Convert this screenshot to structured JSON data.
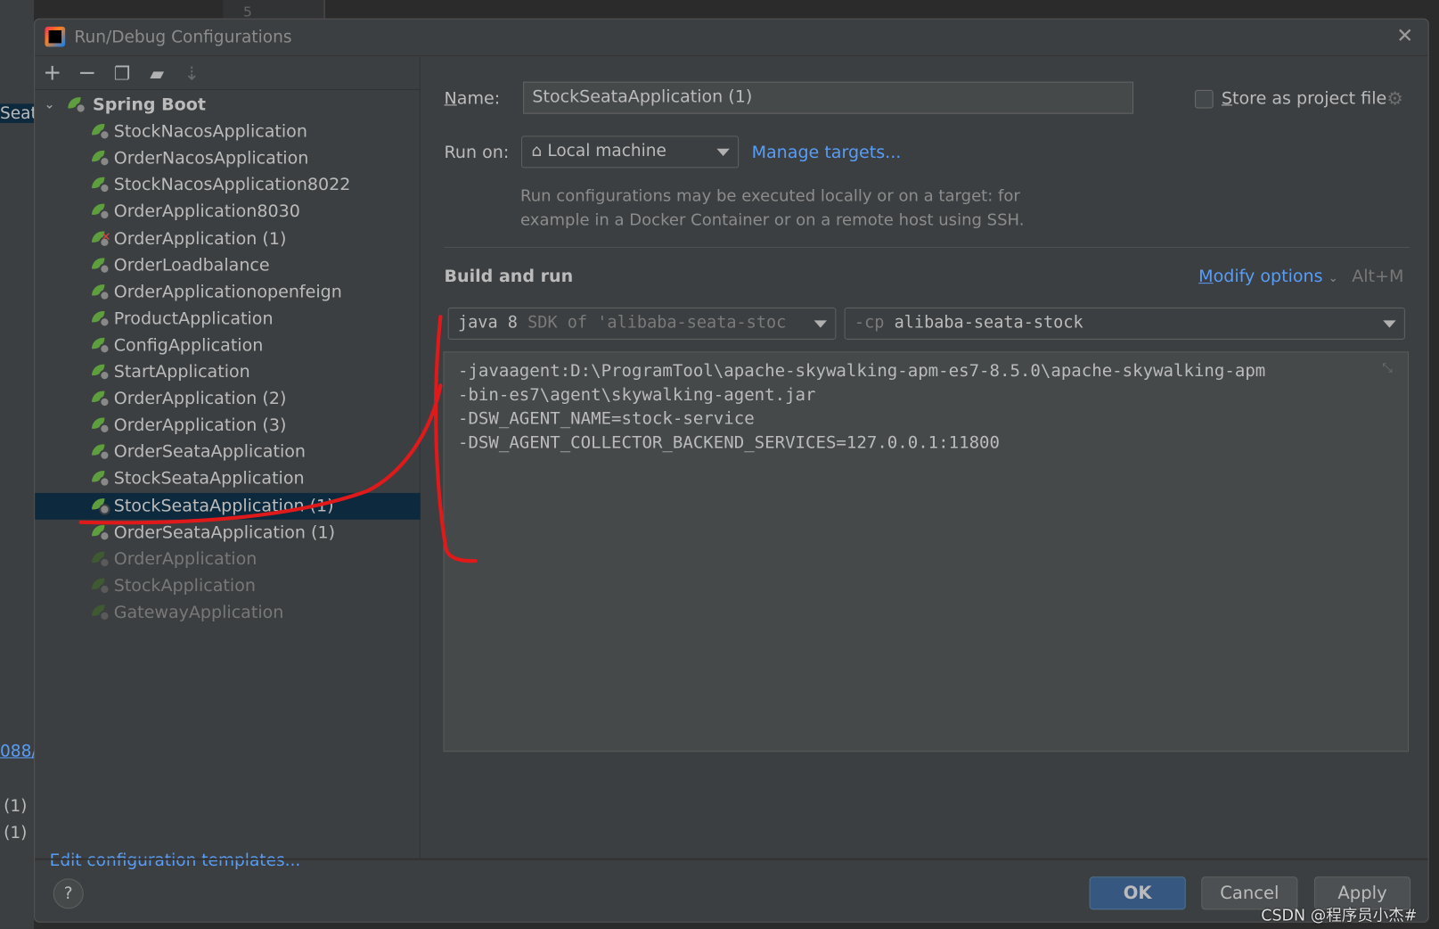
{
  "background_ide": {
    "line_number": "5",
    "left_fragments": [
      "Seat",
      "088/",
      "(1)",
      "(1)"
    ]
  },
  "dialog": {
    "title": "Run/Debug Configurations",
    "toolbar": {
      "add": "+",
      "remove": "−"
    },
    "tree": {
      "group": "Spring Boot",
      "items": [
        {
          "label": "StockNacosApplication",
          "state": "normal"
        },
        {
          "label": "OrderNacosApplication",
          "state": "normal"
        },
        {
          "label": "StockNacosApplication8022",
          "state": "normal"
        },
        {
          "label": "OrderApplication8030",
          "state": "normal"
        },
        {
          "label": "OrderApplication (1)",
          "state": "error"
        },
        {
          "label": "OrderLoadbalance",
          "state": "normal"
        },
        {
          "label": "OrderApplicationopenfeign",
          "state": "normal"
        },
        {
          "label": "ProductApplication",
          "state": "normal"
        },
        {
          "label": "ConfigApplication",
          "state": "normal"
        },
        {
          "label": "StartApplication",
          "state": "normal"
        },
        {
          "label": "OrderApplication (2)",
          "state": "normal"
        },
        {
          "label": "OrderApplication (3)",
          "state": "normal"
        },
        {
          "label": "OrderSeataApplication",
          "state": "normal"
        },
        {
          "label": "StockSeataApplication",
          "state": "normal"
        },
        {
          "label": "StockSeataApplication (1)",
          "state": "selected"
        },
        {
          "label": "OrderSeataApplication (1)",
          "state": "normal"
        },
        {
          "label": "OrderApplication",
          "state": "disabled"
        },
        {
          "label": "StockApplication",
          "state": "disabled"
        },
        {
          "label": "GatewayApplication",
          "state": "disabled"
        }
      ]
    },
    "edit_templates_link": "Edit configuration templates...",
    "name_label": "Name:",
    "name_value": "StockSeataApplication (1)",
    "store_as_project_file": "Store as project file",
    "store_checked": false,
    "run_on_label": "Run on:",
    "run_on_value": "Local machine",
    "manage_targets": "Manage targets...",
    "hint_line1": "Run configurations may be executed locally or on a target: for",
    "hint_line2": "example in a Docker Container or on a remote host using SSH.",
    "build_and_run": "Build and run",
    "modify_options": "Modify options",
    "modify_shortcut": "Alt+M",
    "jdk": {
      "main": "java 8",
      "detail": "SDK of 'alibaba-seata-stoc"
    },
    "classpath": {
      "prefix": "-cp",
      "value": "alibaba-seata-stock"
    },
    "vm_options": "-javaagent:D:\\ProgramTool\\apache-skywalking-apm-es7-8.5.0\\apache-skywalking-apm\n-bin-es7\\agent\\skywalking-agent.jar\n-DSW_AGENT_NAME=stock-service\n-DSW_AGENT_COLLECTOR_BACKEND_SERVICES=127.0.0.1:11800",
    "buttons": {
      "help": "?",
      "ok": "OK",
      "cancel": "Cancel",
      "apply": "Apply"
    }
  },
  "watermark": "CSDN @程序员小杰#",
  "colors": {
    "accent_link": "#589df6",
    "selection": "#0d293e",
    "ok_button": "#365880",
    "annotation": "#e0191b"
  }
}
